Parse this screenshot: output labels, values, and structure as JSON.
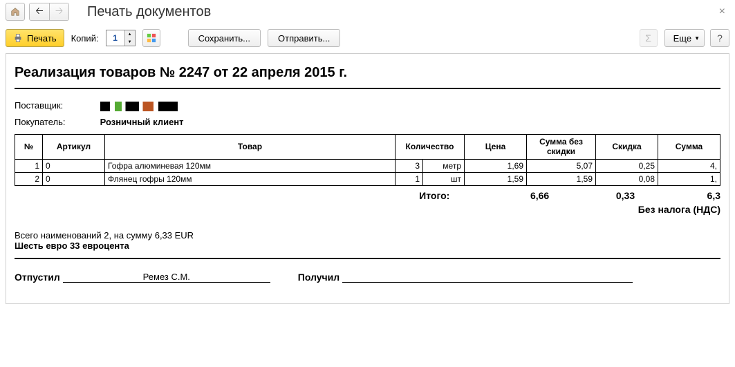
{
  "header": {
    "page_title": "Печать документов"
  },
  "toolbar": {
    "print_label": "Печать",
    "copies_label": "Копий:",
    "copies_value": "1",
    "save_label": "Сохранить...",
    "send_label": "Отправить...",
    "more_label": "Еще",
    "help_label": "?"
  },
  "document": {
    "title": "Реализация товаров № 2247 от 22 апреля 2015 г.",
    "supplier_label": "Поставщик:",
    "buyer_label": "Покупатель:",
    "buyer_value": "Розничный клиент",
    "columns": {
      "num": "№",
      "sku": "Артикул",
      "product": "Товар",
      "qty": "Количество",
      "price": "Цена",
      "sum_no_discount": "Сумма без скидки",
      "discount": "Скидка",
      "sum": "Сумма"
    },
    "rows": [
      {
        "n": "1",
        "sku": "0",
        "name": "Гофра алюминевая 120мм",
        "qty": "3",
        "unit": "метр",
        "price": "1,69",
        "sum_nd": "5,07",
        "disc": "0,25",
        "sum": "4,"
      },
      {
        "n": "2",
        "sku": "0",
        "name": "Флянец гофры 120мм",
        "qty": "1",
        "unit": "шт",
        "price": "1,59",
        "sum_nd": "1,59",
        "disc": "0,08",
        "sum": "1,"
      }
    ],
    "totals": {
      "label": "Итого:",
      "sum_nd": "6,66",
      "disc": "0,33",
      "sum": "6,3",
      "tax_note": "Без налога (НДС)"
    },
    "summary_line": "Всего наименований 2, на сумму 6,33 EUR",
    "sum_words": "Шесть евро 33 евроцента",
    "released_label": "Отпустил",
    "released_name": "Ремез С.М.",
    "received_label": "Получил"
  }
}
